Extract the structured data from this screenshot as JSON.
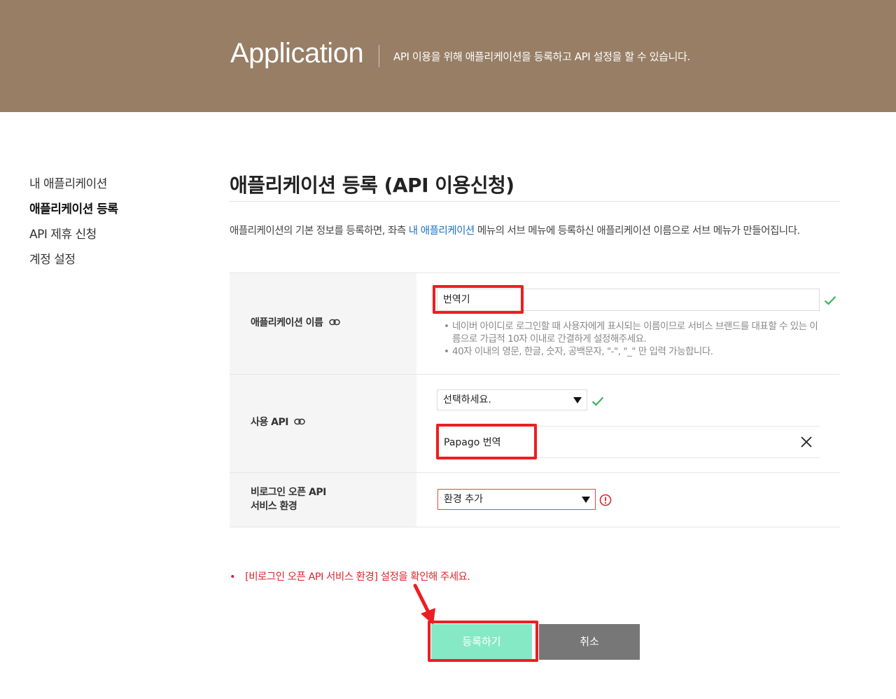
{
  "header": {
    "title": "Application",
    "description": "API 이용을 위해 애플리케이션을 등록하고 API 설정을 할 수 있습니다."
  },
  "sidebar": {
    "items": [
      {
        "label": "내 애플리케이션",
        "active": false
      },
      {
        "label": "애플리케이션 등록",
        "active": true
      },
      {
        "label": "API 제휴 신청",
        "active": false
      },
      {
        "label": "계정 설정",
        "active": false
      }
    ]
  },
  "main": {
    "title": "애플리케이션 등록 (API 이용신청)",
    "intro_before": "애플리케이션의 기본 정보를 등록하면, 좌측 ",
    "intro_link": "내 애플리케이션",
    "intro_after": " 메뉴의 서브 메뉴에 등록하신 애플리케이션 이름으로 서브 메뉴가 만들어집니다."
  },
  "form": {
    "app_name": {
      "label": "애플리케이션 이름",
      "value": "번역기",
      "help": [
        "네이버 아이디로 로그인할 때 사용자에게 표시되는 이름이므로 서비스 브랜드를 대표할 수 있는 이름으로 가급적 10자 이내로 간결하게 설정해주세요.",
        "40자 이내의 영문, 한글, 숫자, 공백문자, \"-\", \"_\" 만 입력 가능합니다."
      ]
    },
    "api": {
      "label": "사용 API",
      "select_value": "선택하세요.",
      "selected_item": "Papago 번역"
    },
    "environment": {
      "label_line1": "비로그인 오픈 API",
      "label_line2": "서비스 환경",
      "select_value": "환경 추가"
    }
  },
  "error": {
    "bullet": "•",
    "message": "[비로그인 오픈 API 서비스 환경] 설정을 확인해 주세요."
  },
  "buttons": {
    "register": "등록하기",
    "cancel": "취소"
  },
  "colors": {
    "banner": "#977e65",
    "link": "#1a73c7",
    "check": "#3cb45a",
    "error": "#d9262c",
    "register_button": "#86e9c5",
    "cancel_button": "#777777",
    "highlight": "#ee1d23"
  }
}
